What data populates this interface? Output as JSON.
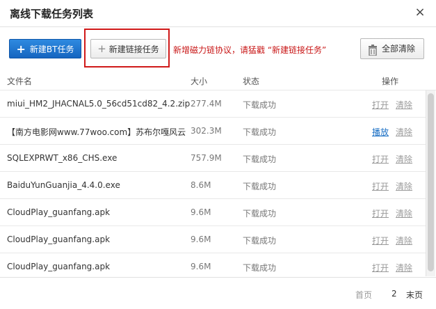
{
  "dialog": {
    "title": "离线下载任务列表",
    "close_label": "×"
  },
  "toolbar": {
    "new_bt_label": "新建BT任务",
    "new_link_label": "新建链接任务",
    "hint": "新增磁力链协议，请猛戳 “新建链接任务”",
    "clear_all_label": "全部清除"
  },
  "table": {
    "headers": {
      "name": "文件名",
      "size": "大小",
      "status": "状态",
      "ops": "操作"
    },
    "rows": [
      {
        "name": "miui_HM2_JHACNAL5.0_56cd51cd82_4.2.zip",
        "size": "277.4M",
        "status": "下载成功",
        "op1": "打开",
        "op2": "清除"
      },
      {
        "name": "【南方电影网www.77woo.com】苏布尔嘎风云",
        "size": "302.3M",
        "status": "下载成功",
        "op1": "播放",
        "op2": "清除"
      },
      {
        "name": "SQLEXPRWT_x86_CHS.exe",
        "size": "757.9M",
        "status": "下载成功",
        "op1": "打开",
        "op2": "清除"
      },
      {
        "name": "BaiduYunGuanjia_4.4.0.exe",
        "size": "8.6M",
        "status": "下载成功",
        "op1": "打开",
        "op2": "清除"
      },
      {
        "name": "CloudPlay_guanfang.apk",
        "size": "9.6M",
        "status": "下载成功",
        "op1": "打开",
        "op2": "清除"
      },
      {
        "name": "CloudPlay_guanfang.apk",
        "size": "9.6M",
        "status": "下载成功",
        "op1": "打开",
        "op2": "清除"
      },
      {
        "name": "CloudPlay_guanfang.apk",
        "size": "9.6M",
        "status": "下载成功",
        "op1": "打开",
        "op2": "清除"
      }
    ]
  },
  "pagination": {
    "prev_label": "首页",
    "current_page": "2",
    "last_label": "末页"
  },
  "colors": {
    "primary_button": "#1565c0",
    "highlight_border": "#d01818",
    "hint_text": "#c81616",
    "play_link": "#1a6fc4"
  }
}
